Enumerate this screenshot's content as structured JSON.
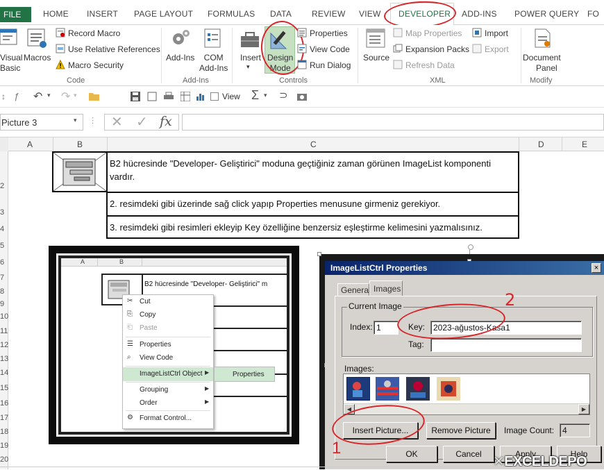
{
  "ribbon": {
    "tabs": [
      "FILE",
      "HOME",
      "INSERT",
      "PAGE LAYOUT",
      "FORMULAS",
      "DATA",
      "REVIEW",
      "VIEW",
      "DEVELOPER",
      "ADD-INS",
      "POWER QUERY",
      "FO"
    ],
    "code_group": {
      "visual_basic": "Visual\nBasic",
      "visual_basic_l1": "Visual",
      "visual_basic_l2": "Basic",
      "macros": "Macros",
      "record_macro": "Record Macro",
      "relative_refs": "Use Relative References",
      "macro_security": "Macro Security",
      "label": "Code"
    },
    "addins_group": {
      "addins": "Add-Ins",
      "com_l1": "COM",
      "com_l2": "Add-Ins",
      "label": "Add-Ins"
    },
    "controls_group": {
      "insert": "Insert",
      "design_l1": "Design",
      "design_l2": "Mode",
      "properties": "Properties",
      "view_code": "View Code",
      "run_dialog": "Run Dialog",
      "label": "Controls"
    },
    "xml_group": {
      "source": "Source",
      "map_properties": "Map Properties",
      "expansion_packs": "Expansion Packs",
      "refresh_data": "Refresh Data",
      "import": "Import",
      "export": "Export",
      "label": "XML"
    },
    "modify_group": {
      "doc_l1": "Document",
      "doc_l2": "Panel",
      "label": "Modify"
    }
  },
  "qat": {
    "view_label": "View"
  },
  "formula_bar": {
    "name_box": "Picture 3",
    "fx": "fx"
  },
  "grid": {
    "columns": [
      "A",
      "B",
      "C",
      "D",
      "E"
    ],
    "rows": [
      "2",
      "3",
      "4",
      "5",
      "6",
      "7",
      "8",
      "9",
      "10",
      "11",
      "12",
      "13",
      "14",
      "15",
      "16",
      "17",
      "18",
      "19",
      "20"
    ]
  },
  "cells": {
    "c2": "B2 hücresinde \"Developer- Geliştirici\" moduna geçtiğiniz zaman görünen ImageList komponenti vardır.",
    "c3": "2. resimdeki gibi üzerinde sağ click yapıp Properties menusune girmeniz gerekiyor.",
    "c4": "3. resimdeki gibi resimleri ekleyip Key özelliğine benzersiz eşleştirme kelimesini yazmalısınız."
  },
  "shot1": {
    "cols": [
      "A",
      "B"
    ],
    "cell_text": "B2 hücresinde \"Developer- Geliştirici\" m",
    "menu": [
      "Cut",
      "Copy",
      "Paste",
      "Properties",
      "View Code",
      "ImageListCtrl Object",
      "Grouping",
      "Order",
      "Format Control..."
    ],
    "submenu": "Properties"
  },
  "dialog": {
    "title": "ImageListCtrl Properties",
    "close": "×",
    "tabs": [
      "General",
      "Images"
    ],
    "current_image": "Current Image",
    "index_label": "Index:",
    "index_value": "1",
    "key_label": "Key:",
    "key_value": "2023-ağustos-Kasa1",
    "tag_label": "Tag:",
    "tag_value": "",
    "images_label": "Images:",
    "insert_picture": "Insert Picture...",
    "remove_picture": "Remove Picture",
    "image_count_label": "Image Count:",
    "image_count": "4",
    "ok": "OK",
    "cancel": "Cancel",
    "apply": "Apply",
    "help": "Help"
  },
  "annotations": {
    "num1": "1",
    "num2": "2"
  },
  "watermark": "EXCELDEPO",
  "colors": {
    "excel_green": "#217346",
    "annotation_red": "#d9262b",
    "dialog_title": "#0a246a",
    "design_mode_bg": "#c6e0c2"
  }
}
